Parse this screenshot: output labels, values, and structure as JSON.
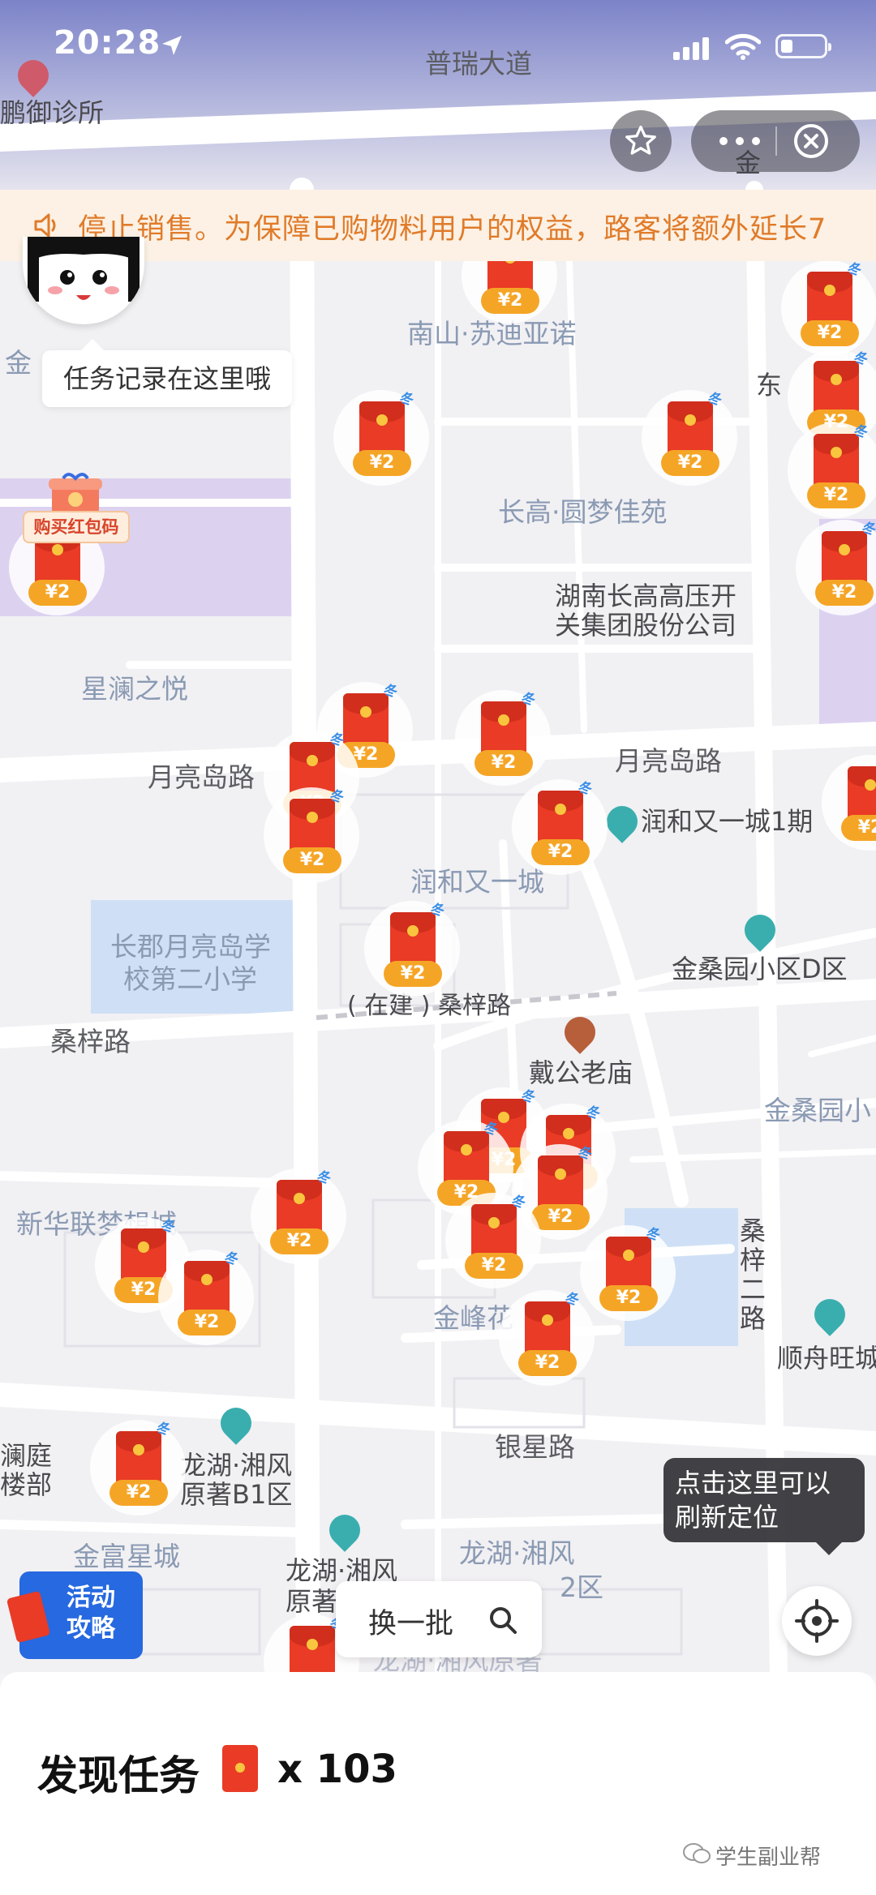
{
  "status_bar": {
    "time": "20:28"
  },
  "notice": {
    "text": "停止销售。为保障已购物料用户的权益，路客将额外延长7"
  },
  "avatar_tip": "任务记录在这里哦",
  "buy_code_label": "购买红包码",
  "marker_tag": "冬",
  "marker_amount": "¥2",
  "map_labels": {
    "road_top": "普瑞大道",
    "clinic": "鹏御诊所",
    "jin_top": "金",
    "jin_left": "金",
    "dongjing": "东",
    "nanshan": "南山·苏迪亚诺",
    "changgao": "长高·圆梦佳苑",
    "hunan_1": "湖南长高高压开",
    "hunan_2": "关集团股份公司",
    "xinglan": "星澜之悦",
    "yueliang_left": "月亮岛路",
    "yueliang_right": "月亮岛路",
    "runhe_1": "润和又一城1期",
    "runhe": "润和又一城",
    "school_1": "长郡月亮岛学",
    "school_2": "校第二小学",
    "sangzi": "桑梓路",
    "sangzi_build": "( 在建 ) 桑梓路",
    "jinsang_d": "金桑园小区D区",
    "daigong": "戴公老庙",
    "jinsang_right": "金桑园小",
    "xinhua": "新华联梦想城",
    "jinfeng": "金峰花",
    "sangzi_2": "桑梓二路",
    "shunzhou": "顺舟旺城",
    "yinxing": "银星路",
    "lanting_1": "澜庭",
    "lanting_2": "楼部",
    "longhu_b1_1": "龙湖·湘风",
    "longhu_b1_2": "原著B1区",
    "jinfu": "金富星城",
    "longhu_2q_1": "龙湖·湘风",
    "longhu_2q_2": "2区",
    "longhu_y_1": "龙湖·湘风",
    "longhu_y_2": "原著",
    "bottom_faint": "龙湖·湘风原著"
  },
  "refresh_tip": "点击这里可以刷新定位",
  "swap_button": "换一批",
  "guide_button": "活动攻略",
  "panel": {
    "title": "发现任务",
    "count": "x 103",
    "watermark": "学生副业帮"
  },
  "colors": {
    "accent_red": "#e93b26",
    "amount_orange": "#f5a526",
    "tag_blue": "#3a8ee6",
    "notice_text": "#e07b2a",
    "guide_blue": "#2669e0"
  }
}
